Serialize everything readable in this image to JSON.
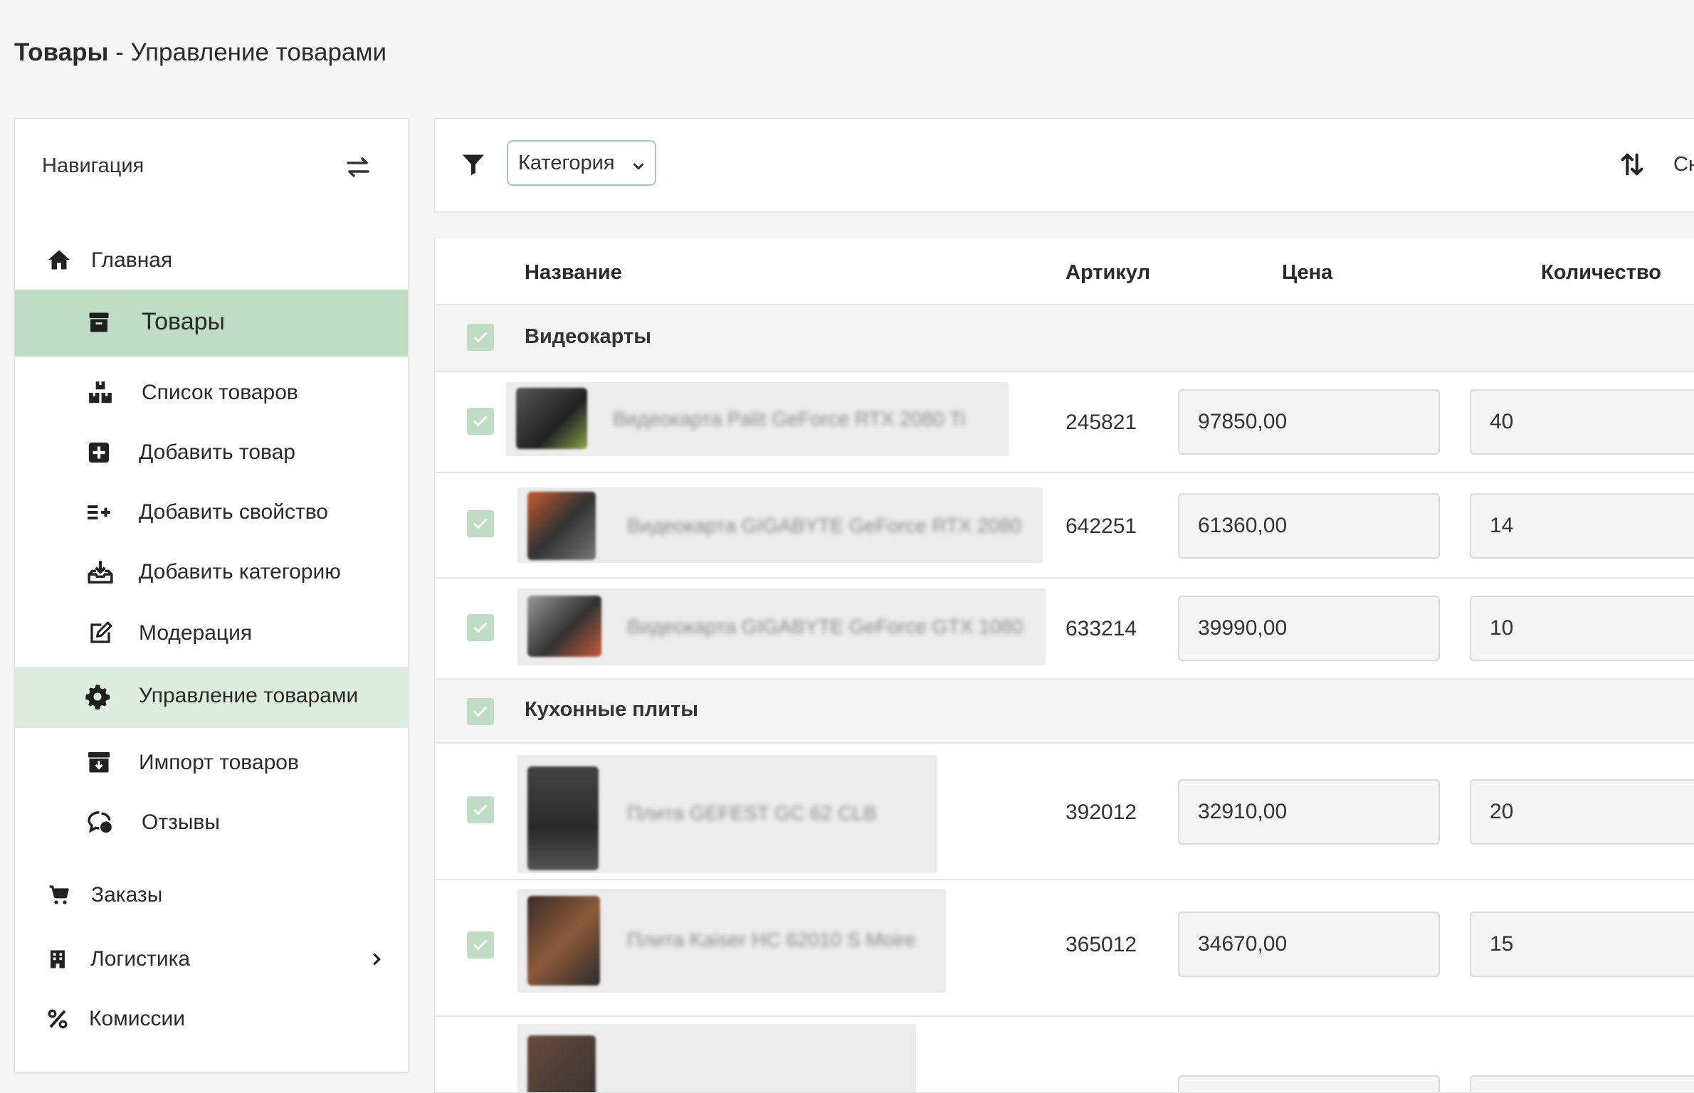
{
  "page": {
    "title_bold": "Товары",
    "title_rest": " - Управление товарами"
  },
  "sidebar": {
    "header": "Навигация",
    "items": [
      {
        "label": "Главная",
        "icon": "home-icon"
      },
      {
        "label": "Товары",
        "icon": "archive-box-icon",
        "state": "expanded"
      },
      {
        "label": "Список товаров",
        "icon": "boxes-icon"
      },
      {
        "label": "Добавить товар",
        "icon": "plus-square-icon"
      },
      {
        "label": "Добавить свойство",
        "icon": "list-plus-icon"
      },
      {
        "label": "Добавить категорию",
        "icon": "tray-download-icon"
      },
      {
        "label": "Модерация",
        "icon": "edit-icon"
      },
      {
        "label": "Управление товарами",
        "icon": "gear-icon",
        "state": "active"
      },
      {
        "label": "Импорт товаров",
        "icon": "inbox-import-icon"
      },
      {
        "label": "Отзывы",
        "icon": "comment-icon"
      },
      {
        "label": "Заказы",
        "icon": "cart-icon"
      },
      {
        "label": "Логистика",
        "icon": "building-icon"
      },
      {
        "label": "Комиссии",
        "icon": "percent-icon"
      }
    ]
  },
  "toolbar": {
    "filter_select": "Категория",
    "sort_label": "Сн"
  },
  "table": {
    "headers": {
      "name": "Название",
      "sku": "Артикул",
      "price": "Цена",
      "qty": "Количество"
    },
    "groups": [
      {
        "name": "Видеокарты",
        "rows": [
          {
            "name": "Видеокарта Palit GeForce RTX 2080 Ti",
            "sku": "245821",
            "price": "97850,00",
            "qty": "40"
          },
          {
            "name": "Видеокарта GIGABYTE GeForce RTX 2080",
            "sku": "642251",
            "price": "61360,00",
            "qty": "14"
          },
          {
            "name": "Видеокарта GIGABYTE GeForce GTX 1080",
            "sku": "633214",
            "price": "39990,00",
            "qty": "10"
          }
        ]
      },
      {
        "name": "Кухонные плиты",
        "rows": [
          {
            "name": "Плита GEFEST GC 62 CLB",
            "sku": "392012",
            "price": "32910,00",
            "qty": "20"
          },
          {
            "name": "Плита Kaiser HC 62010 S Moire",
            "sku": "365012",
            "price": "34670,00",
            "qty": "15"
          }
        ]
      }
    ]
  },
  "colors": {
    "accent_active": "#bfdcc4",
    "accent_active_sub": "#dcecde",
    "checkbox": "#bfdcc4",
    "select_border": "#9fd0a6"
  }
}
